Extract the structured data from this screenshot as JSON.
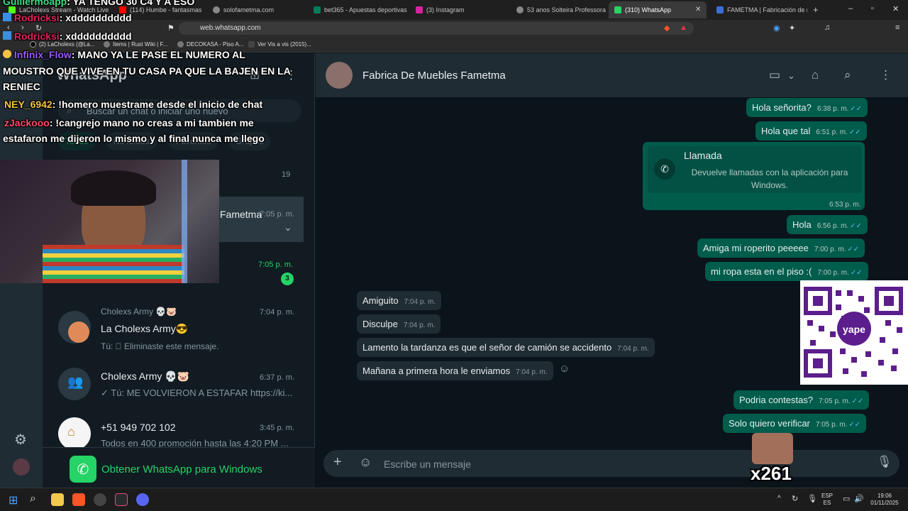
{
  "browser": {
    "tabs": [
      {
        "label": "LaCholexs Stream - Watch Live"
      },
      {
        "label": "(114) Humbe - fantasmas"
      },
      {
        "label": "solofametma.com"
      },
      {
        "label": "bet365 - Apuestas deportivas"
      },
      {
        "label": "(3) Instagram"
      },
      {
        "label": "53 anos Solteira Professora Pr"
      },
      {
        "label": "(310) WhatsApp"
      },
      {
        "label": "FAMETMA | Fabricación de mu"
      }
    ],
    "url": "web.whatsapp.com",
    "bookmarks": [
      {
        "label": "(2) LaCholexs (@La..."
      },
      {
        "label": "Items | Rust Wiki | F..."
      },
      {
        "label": "DECOKASA - Piso A..."
      },
      {
        "label": "Ver Vis a vis (2015)..."
      }
    ]
  },
  "sidebar": {
    "title": "WhatsApp",
    "search_placeholder": "Buscar un chat o iniciar uno nuevo",
    "filters": [
      "Todos",
      "No leídos",
      "Favoritos",
      "Grupos"
    ],
    "chats": [
      {
        "time": "19"
      },
      {
        "name": "Fametma",
        "time": "7:05 p. m."
      },
      {
        "time": "7:05 p. m.",
        "unread": "3"
      },
      {
        "group": "Cholexs Army 💀🐷",
        "name": "La Cholexs Army😎",
        "time": "7:04 p. m.",
        "preview": "Tú: ⃠ Eliminaste este mensaje."
      },
      {
        "name": "Cholexs Army 💀🐷",
        "time": "6:37 p. m.",
        "preview": "✓ Tú: ME VOLVIERON A ESTAFAR https://ki..."
      },
      {
        "name": "+51 949 702 102",
        "time": "3:45 p. m.",
        "preview": "Todos en 400 promoción hasta las 4:20 PM ..."
      }
    ],
    "get_app": "Obtener WhatsApp para Windows"
  },
  "conversation": {
    "contact": "Fabrica De Muebles Fametma",
    "messages_out_top": [
      {
        "text": "Hola señorita?",
        "time": "6:38 p. m."
      },
      {
        "text": "Hola que tal",
        "time": "6:51 p. m."
      }
    ],
    "call": {
      "title": "Llamada",
      "sub": "Devuelve llamadas con la aplicación para Windows.",
      "time": "6:53 p. m."
    },
    "messages_out_mid": [
      {
        "text": "Hola",
        "time": "6:56 p. m."
      },
      {
        "text": "Amiga mi roperito peeeee",
        "time": "7:00 p. m."
      },
      {
        "text": "mi ropa esta en el piso :(",
        "time": "7:00 p. m."
      }
    ],
    "messages_in": [
      {
        "text": "Amiguito",
        "time": "7:04 p. m."
      },
      {
        "text": "Disculpe",
        "time": "7:04 p. m."
      },
      {
        "text": "Lamento la tardanza es que el señor de camión se accidento",
        "time": "7:04 p. m."
      },
      {
        "text": "Mañana a primera hora le enviamos",
        "time": "7:04 p. m."
      }
    ],
    "messages_out_bottom": [
      {
        "text": "Podria contestas?",
        "time": "7:05 p. m."
      },
      {
        "text": "Solo quiero verificar",
        "time": "7:05 p. m."
      }
    ],
    "compose_placeholder": "Escribe un mensaje"
  },
  "stream_chat": [
    {
      "user": "Guillermoapp",
      "color": "#3ddc84",
      "text": "YA TENGO 30 C4 Y A ESO"
    },
    {
      "user": "Rodricksi",
      "color": "#e0245e",
      "text": "xdddddddddd"
    },
    {
      "user": "Rodricksi",
      "color": "#e0245e",
      "text": "xdddddddddd"
    },
    {
      "user": "Infinix_Flow",
      "color": "#9b59ff",
      "text": "MANO YA LE PASE EL NUMERO AL"
    },
    {
      "text": "MOUSTRO QUE VIVE EN TU CASA PA QUE LA BAJEN EN LA"
    },
    {
      "text": "RENIEC"
    },
    {
      "user": "NEY_6942",
      "color": "#f5c542",
      "text": "!homero muestrame desde el inicio de chat"
    },
    {
      "user": "zJackooo",
      "color": "#ff4d6d",
      "text": "!cangrejo mano no creas a mi tambien me"
    },
    {
      "text": "estafaron me dijeron lo mismo y al final nunca me llego"
    }
  ],
  "overlay": {
    "qr_brand": "yape",
    "counter": "x261"
  },
  "taskbar": {
    "lang": "ESP",
    "lang2": "ES",
    "time": "19:06",
    "date": "01/11/2025"
  }
}
